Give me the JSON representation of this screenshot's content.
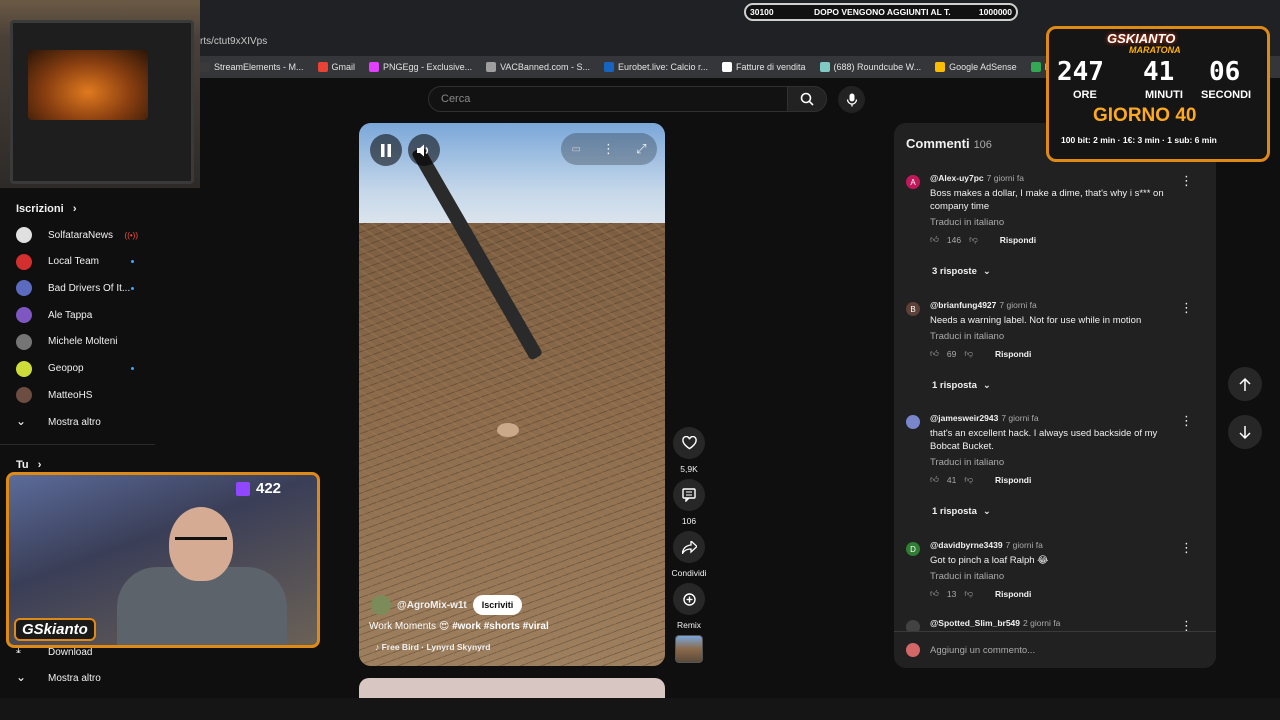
{
  "browser": {
    "url_fragment": "rts/ctut9xXIVps",
    "bookmarks": [
      {
        "label": "StreamElements - M...",
        "color": "#3a3a3a"
      },
      {
        "label": "Gmail",
        "color": "#ea4335"
      },
      {
        "label": "PNGEgg - Exclusive...",
        "color": "#e040fb"
      },
      {
        "label": "VACBanned.com - S...",
        "color": "#9e9e9e"
      },
      {
        "label": "Eurobet.live: Calcio r...",
        "color": "#1565c0"
      },
      {
        "label": "Fatture di vendita",
        "color": "#ffffff"
      },
      {
        "label": "(688) Roundcube W...",
        "color": "#80cbc4"
      },
      {
        "label": "Google AdSense",
        "color": "#fbbc04"
      },
      {
        "label": "Fogli Google",
        "color": "#34a853"
      },
      {
        "label": "txAdmin",
        "color": "#43a047"
      }
    ]
  },
  "goal": {
    "start": "30100",
    "text": "DOPO VENGONO AGGIUNTI AL T.",
    "end": "1000000",
    "progress": 0.03
  },
  "search": {
    "placeholder": "Cerca"
  },
  "sidebar": {
    "subscriptions_label": "Iscrizioni",
    "items": [
      {
        "label": "SolfataraNews",
        "color": "#e0e0e0",
        "live": true
      },
      {
        "label": "Local Team",
        "color": "#d32f2f",
        "dot": true
      },
      {
        "label": "Bad Drivers Of It...",
        "color": "#5c6bc0",
        "dot": true
      },
      {
        "label": "Ale Tappa",
        "color": "#7e57c2",
        "dot": false
      },
      {
        "label": "Michele Molteni",
        "color": "#757575",
        "dot": false
      },
      {
        "label": "Geopop",
        "color": "#cddc39",
        "dot": true
      },
      {
        "label": "MatteoHS",
        "color": "#6d4c41",
        "dot": false
      }
    ],
    "show_more_label": "Mostra altro",
    "you_label": "Tu",
    "download_label": "Download",
    "show_more_label_2": "Mostra altro",
    "live_icon": "((•))"
  },
  "stream": {
    "viewers": "422",
    "logo": "GSkianto"
  },
  "player": {
    "channel": "@AgroMix-w1t",
    "subscribe_label": "Iscriviti",
    "title_text": "Work Moments",
    "title_emoji": "😍",
    "title_tags": "#work #shorts #viral",
    "music": "♪ Free Bird · Lynyrd Skynyrd"
  },
  "actions": {
    "likes": "5,9K",
    "comments": "106",
    "share_label": "Condividi",
    "remix_label": "Remix"
  },
  "comments": {
    "title": "Commenti",
    "count": "106",
    "translate_label": "Traduci in italiano",
    "reply_label": "Rispondi",
    "input_placeholder": "Aggiungi un commento...",
    "items": [
      {
        "initial": "A",
        "color": "#c2185b",
        "author": "@Alex-uy7pc",
        "time": "7 giorni fa",
        "text": "Boss makes a dollar, I make a dime, that's why i s*** on company time",
        "likes": "146",
        "replies": "3 risposte"
      },
      {
        "initial": "B",
        "color": "#5d4037",
        "author": "@brianfung4927",
        "time": "7 giorni fa",
        "text": "Needs a warning label. Not for use while in motion",
        "likes": "69",
        "replies": "1 risposta"
      },
      {
        "initial": "",
        "color": "#7986cb",
        "author": "@jamesweir2943",
        "time": "7 giorni fa",
        "text": "that's an excellent hack. I always used backside of my Bobcat Bucket.",
        "likes": "41",
        "replies": "1 risposta"
      },
      {
        "initial": "D",
        "color": "#2e7d32",
        "author": "@davidbyrne3439",
        "time": "7 giorni fa",
        "text": "Got to pinch a loaf Ralph 😂",
        "likes": "13",
        "replies": ""
      },
      {
        "initial": "",
        "color": "#424242",
        "author": "@Spotted_Slim_br549",
        "time": "2 giorni fa",
        "text": "",
        "likes": "",
        "replies": ""
      }
    ]
  },
  "timer": {
    "brand": "GSKIANTO",
    "subtitle": "MARATONA",
    "hours": "247",
    "minutes": "41",
    "seconds": "06",
    "hours_label": "ORE",
    "minutes_label": "MINUTI",
    "seconds_label": "SECONDI",
    "day_label": "GIORNO 40",
    "rates": "100 bit: 2 min · 1€: 3 min · 1 sub: 6 min"
  }
}
